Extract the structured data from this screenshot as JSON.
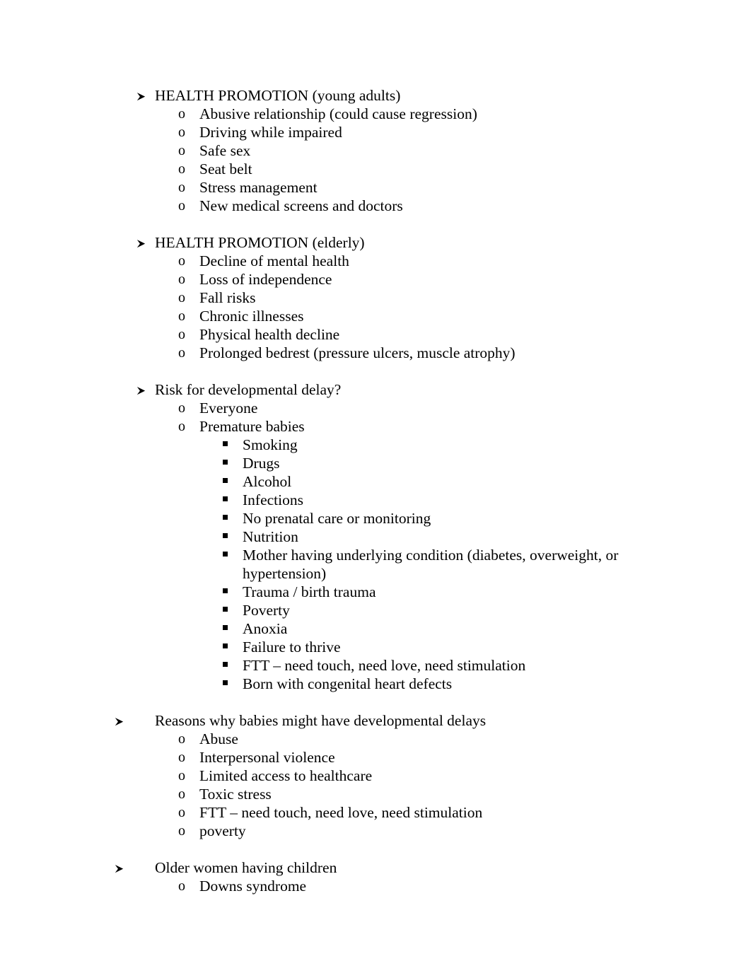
{
  "document": {
    "page_background": "#ffffff",
    "text_color": "#000000",
    "markers": {
      "level1": "arrow-bullet",
      "level2": "o",
      "level3": "square-bullet"
    },
    "sections": [
      {
        "heading": "HEALTH PROMOTION (young adults)",
        "indent": "deep",
        "items": [
          {
            "text": "Abusive relationship (could cause regression)"
          },
          {
            "text": "Driving while impaired"
          },
          {
            "text": "Safe sex"
          },
          {
            "text": "Seat belt"
          },
          {
            "text": "Stress management"
          },
          {
            "text": "New medical screens and doctors"
          }
        ]
      },
      {
        "heading": "HEALTH PROMOTION (elderly)",
        "indent": "deep",
        "items": [
          {
            "text": "Decline of mental health"
          },
          {
            "text": "Loss of independence"
          },
          {
            "text": "Fall risks"
          },
          {
            "text": "Chronic illnesses"
          },
          {
            "text": "Physical health decline"
          },
          {
            "text": "Prolonged bedrest (pressure ulcers, muscle atrophy)"
          }
        ]
      },
      {
        "heading": "Risk for developmental delay?",
        "indent": "deep",
        "items": [
          {
            "text": "Everyone"
          },
          {
            "text": "Premature babies",
            "subitems": [
              {
                "text": "Smoking"
              },
              {
                "text": "Drugs"
              },
              {
                "text": "Alcohol"
              },
              {
                "text": "Infections"
              },
              {
                "text": "No prenatal care or monitoring"
              },
              {
                "text": "Nutrition"
              },
              {
                "text": "Mother having underlying condition (diabetes, overweight, or hypertension)"
              },
              {
                "text": "Trauma / birth trauma"
              },
              {
                "text": "Poverty"
              },
              {
                "text": "Anoxia"
              },
              {
                "text": "Failure to thrive"
              },
              {
                "text": "FTT – need touch, need love, need stimulation"
              },
              {
                "text": "Born with congenital heart defects"
              }
            ]
          }
        ]
      },
      {
        "heading": "Reasons why babies might have developmental delays",
        "indent": "shallow",
        "items": [
          {
            "text": "Abuse"
          },
          {
            "text": "Interpersonal violence"
          },
          {
            "text": "Limited access to healthcare"
          },
          {
            "text": "Toxic stress"
          },
          {
            "text": "FTT – need touch, need love, need stimulation"
          },
          {
            "text": "poverty"
          }
        ]
      },
      {
        "heading": "Older women having children",
        "indent": "shallow",
        "items": [
          {
            "text": "Downs syndrome"
          }
        ]
      }
    ]
  }
}
